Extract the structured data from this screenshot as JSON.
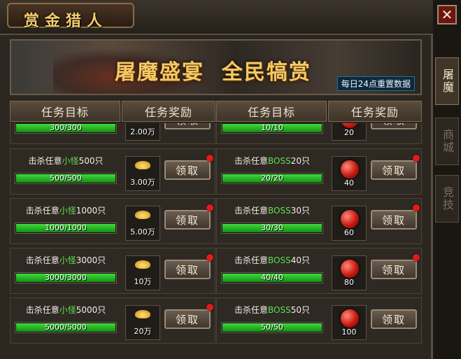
{
  "window": {
    "title": "赏金猎人",
    "close_label": "✕"
  },
  "side_tabs": [
    {
      "label": "屠魔",
      "active": true
    },
    {
      "label": "商城",
      "active": false
    },
    {
      "label": "竞技",
      "active": false
    }
  ],
  "banner": {
    "title": "屠魔盛宴  全民犒赏",
    "note": "每日24点重置数据"
  },
  "headers": [
    "任务目标",
    "任务奖励",
    "任务目标",
    "任务奖励"
  ],
  "claim_label": "领取",
  "left_rows": [
    {
      "task_prefix": "",
      "task_highlight": "",
      "task_suffix": "",
      "progress": "300/300",
      "progress_fraction": 1,
      "reward_type": "gold",
      "reward": "2.00万",
      "has_dot": false
    },
    {
      "task_prefix": "击杀任意",
      "task_highlight": "小怪",
      "task_suffix": "500只",
      "progress": "500/500",
      "progress_fraction": 1,
      "reward_type": "gold",
      "reward": "3.00万",
      "has_dot": true
    },
    {
      "task_prefix": "击杀任意",
      "task_highlight": "小怪",
      "task_suffix": "1000只",
      "progress": "1000/1000",
      "progress_fraction": 1,
      "reward_type": "gold",
      "reward": "5.00万",
      "has_dot": true
    },
    {
      "task_prefix": "击杀任意",
      "task_highlight": "小怪",
      "task_suffix": "3000只",
      "progress": "3000/3000",
      "progress_fraction": 1,
      "reward_type": "gold",
      "reward": "10万",
      "has_dot": true
    },
    {
      "task_prefix": "击杀任意",
      "task_highlight": "小怪",
      "task_suffix": "5000只",
      "progress": "5000/5000",
      "progress_fraction": 1,
      "reward_type": "gold",
      "reward": "20万",
      "has_dot": true
    }
  ],
  "right_rows": [
    {
      "task_prefix": "",
      "task_highlight": "",
      "task_suffix": "",
      "progress": "10/10",
      "progress_fraction": 1,
      "reward_type": "orb",
      "reward": "20",
      "has_dot": false
    },
    {
      "task_prefix": "击杀任意",
      "task_highlight": "BOSS",
      "task_suffix": "20只",
      "progress": "20/20",
      "progress_fraction": 1,
      "reward_type": "orb",
      "reward": "40",
      "has_dot": true
    },
    {
      "task_prefix": "击杀任意",
      "task_highlight": "BOSS",
      "task_suffix": "30只",
      "progress": "30/30",
      "progress_fraction": 1,
      "reward_type": "orb",
      "reward": "60",
      "has_dot": true
    },
    {
      "task_prefix": "击杀任意",
      "task_highlight": "BOSS",
      "task_suffix": "40只",
      "progress": "40/40",
      "progress_fraction": 1,
      "reward_type": "orb",
      "reward": "80",
      "has_dot": true
    },
    {
      "task_prefix": "击杀任意",
      "task_highlight": "BOSS",
      "task_suffix": "50只",
      "progress": "50/50",
      "progress_fraction": 1,
      "reward_type": "orb",
      "reward": "100",
      "has_dot": false
    }
  ]
}
